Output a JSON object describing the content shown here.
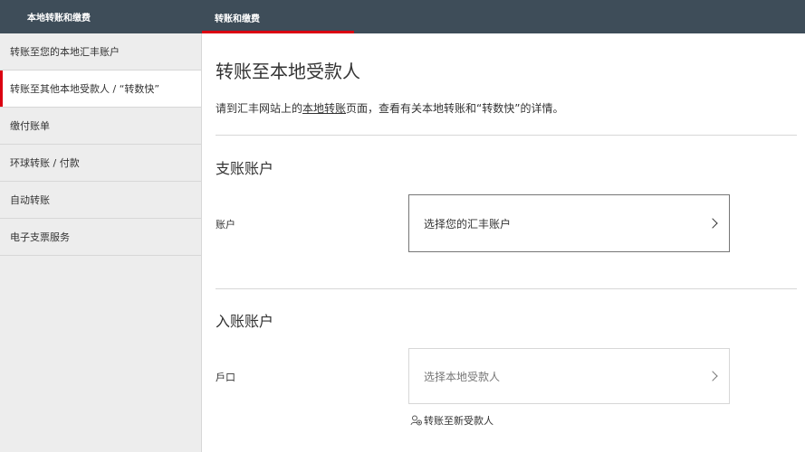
{
  "topbar": {
    "left_title": "本地转账和缴费",
    "tab_label": "转账和缴费"
  },
  "colors": {
    "header_bg": "#3e4d59",
    "accent": "#db0011",
    "sidebar_bg": "#ededed"
  },
  "sidebar": {
    "items": [
      {
        "label": "转账至您的本地汇丰账户"
      },
      {
        "label": "转账至其他本地受款人 / “转数快”"
      },
      {
        "label": "缴付账单"
      },
      {
        "label": "环球转账 / 付款"
      },
      {
        "label": "自动转账"
      },
      {
        "label": "电子支票服务"
      }
    ],
    "active_index": 1
  },
  "main": {
    "title": "转账至本地受款人",
    "intro_before": "请到汇丰网站上的",
    "intro_link": "本地转账",
    "intro_after": "页面，查看有关本地转账和“转数快”的详情。",
    "from_section": {
      "title": "支账账户",
      "field_label": "账户",
      "select_text": "选择您的汇丰账户"
    },
    "to_section": {
      "title": "入账账户",
      "field_label": "戶口",
      "select_text": "选择本地受款人",
      "add_new_label": "转账至新受款人",
      "add_new_icon": "add-user-icon"
    }
  }
}
